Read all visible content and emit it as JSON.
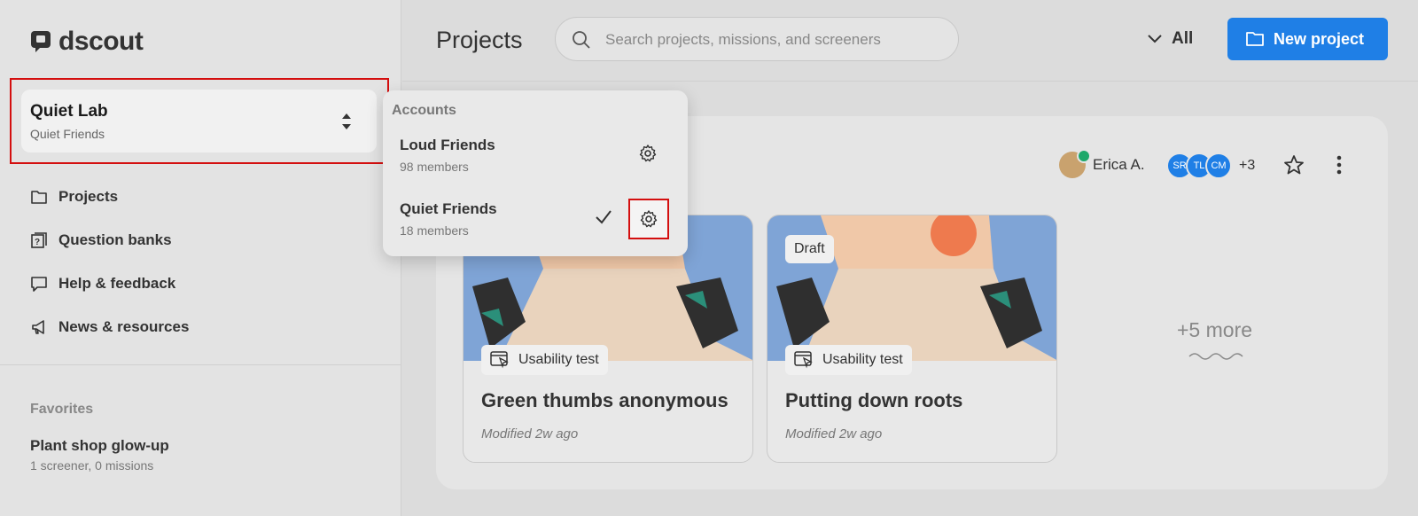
{
  "app": {
    "name": "dscout"
  },
  "sidebar": {
    "account": {
      "name": "Quiet Lab",
      "org": "Quiet Friends"
    },
    "nav": [
      {
        "label": "Projects",
        "icon": "folder-icon"
      },
      {
        "label": "Question banks",
        "icon": "question-bank-icon"
      },
      {
        "label": "Help & feedback",
        "icon": "chat-bubble-icon"
      },
      {
        "label": "News & resources",
        "icon": "megaphone-icon"
      }
    ],
    "favorites": {
      "title": "Favorites",
      "items": [
        {
          "name": "Plant shop glow-up",
          "meta": "1 screener, 0 missions"
        }
      ]
    }
  },
  "header": {
    "title": "Projects",
    "search_placeholder": "Search projects, missions, and screeners",
    "filter_label": "All",
    "new_button": "New project"
  },
  "dropdown": {
    "heading": "Accounts",
    "items": [
      {
        "name": "Loud Friends",
        "members": "98 members",
        "selected": false
      },
      {
        "name": "Quiet Friends",
        "members": "18 members",
        "selected": true
      }
    ]
  },
  "project": {
    "owner": "Erica A.",
    "collaborators": [
      "SR",
      "TL",
      "CM"
    ],
    "more_collaborators": "+3",
    "missions": [
      {
        "type": "Usability test",
        "title": "Green thumbs anonymous",
        "modified": "Modified 2w ago",
        "badge": ""
      },
      {
        "type": "Usability test",
        "title": "Putting down roots",
        "modified": "Modified 2w ago",
        "badge": "Draft"
      }
    ],
    "more_label": "+5 more"
  },
  "colors": {
    "accent": "#1f7fe6",
    "highlight": "#d40f0f",
    "verified": "#1ea86a"
  }
}
